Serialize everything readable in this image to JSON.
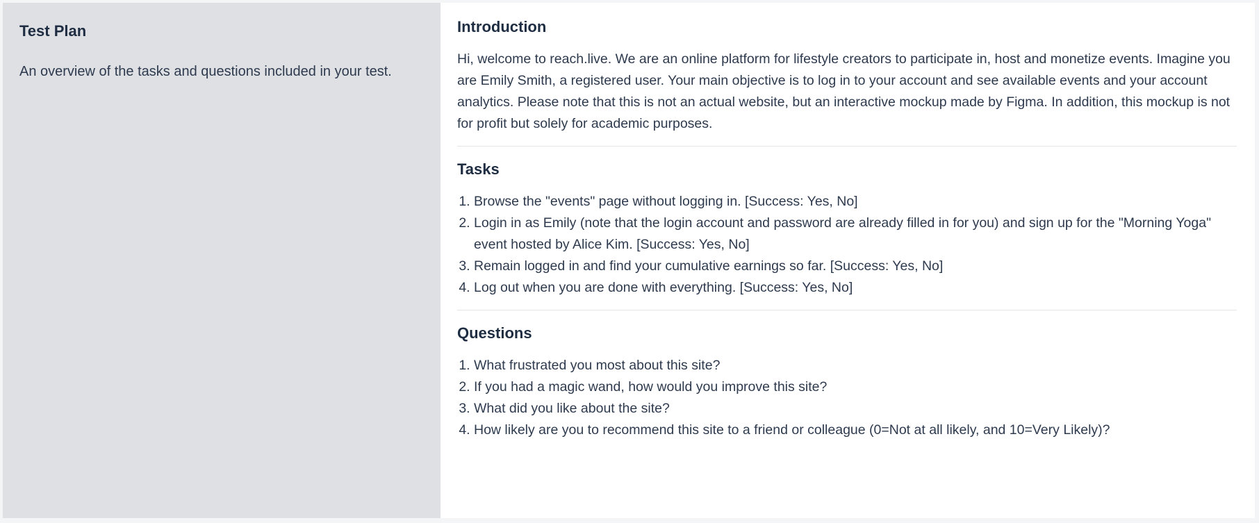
{
  "sidebar": {
    "title": "Test Plan",
    "subtitle": "An overview of the tasks and questions included in your test."
  },
  "introduction": {
    "heading": "Introduction",
    "body": "Hi, welcome to reach.live. We are an online platform for lifestyle creators to participate in, host and monetize events. Imagine you are Emily Smith, a registered user. Your main objective is to log in to your account and see available events and your account analytics. Please note that this is not an actual website, but an interactive mockup made by Figma. In addition, this mockup is not for profit but solely for academic purposes."
  },
  "tasks": {
    "heading": "Tasks",
    "items": [
      "Browse the \"events\" page without logging in. [Success: Yes, No]",
      "Login in as Emily (note that the login account and password are already filled in for you) and sign up for the \"Morning Yoga\" event hosted by Alice Kim. [Success: Yes, No]",
      "Remain logged in and find your cumulative earnings so far. [Success: Yes, No]",
      "Log out when you are done with everything. [Success: Yes, No]"
    ]
  },
  "questions": {
    "heading": "Questions",
    "items": [
      "What frustrated you most about this site?",
      "If you had a magic wand, how would you improve this site?",
      "What did you like about the site?",
      "How likely are you to recommend this site to a friend or colleague (0=Not at all likely, and 10=Very Likely)?"
    ]
  }
}
